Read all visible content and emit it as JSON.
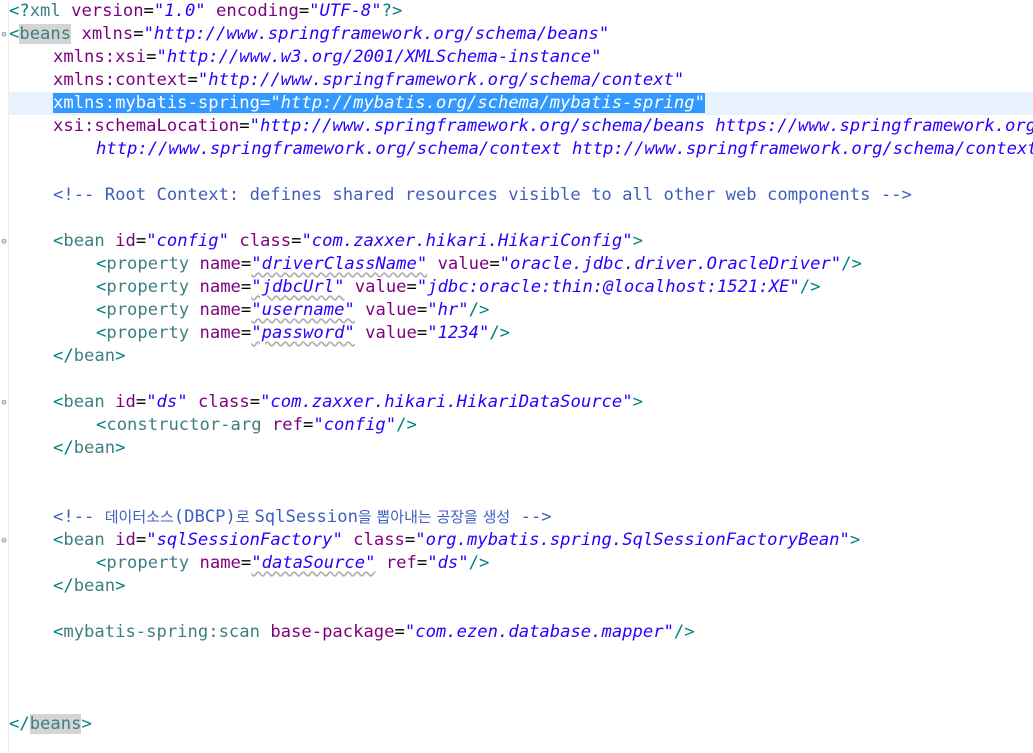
{
  "editor": {
    "lines": {
      "l1": {
        "open": "<?",
        "tag": "xml",
        "a1": "version",
        "v1": "\"1.0\"",
        "a2": "encoding",
        "v2": "\"UTF-8\"",
        "close": "?>"
      },
      "l2": {
        "open": "<",
        "tag": "beans",
        "a1": "xmlns",
        "v1": "\"http://www.springframework.org/schema/beans\""
      },
      "l3": {
        "a1": "xmlns:xsi",
        "v1": "\"http://www.w3.org/2001/XMLSchema-instance\""
      },
      "l4": {
        "a1": "xmlns:context",
        "v1": "\"http://www.springframework.org/schema/context\""
      },
      "l5": {
        "a1": "xmlns:mybatis-spring",
        "v1": "\"http://mybatis.org/schema/mybatis-spring\""
      },
      "l6": {
        "a1": "xsi:schemaLocation",
        "v1": "\"http://www.springframework.org/schema/beans https://www.springframework.org/schema/beans/spring-beans.xsd"
      },
      "l7": {
        "v1": "http://www.springframework.org/schema/context http://www.springframework.org/schema/context/spring-context.xsd\">"
      },
      "l9": {
        "comment": "<!-- Root Context: defines shared resources visible to all other web components -->"
      },
      "l11": {
        "open": "<",
        "tag": "bean",
        "a1": "id",
        "v1": "\"config\"",
        "a2": "class",
        "v2": "\"com.zaxxer.hikari.HikariConfig\"",
        "close": ">"
      },
      "l12": {
        "open": "<",
        "tag": "property",
        "a1": "name",
        "v1": "\"driverClassName\"",
        "a2": "value",
        "v2": "\"oracle.jdbc.driver.OracleDriver\"",
        "close": "/>"
      },
      "l13": {
        "open": "<",
        "tag": "property",
        "a1": "name",
        "v1": "\"jdbcUrl\"",
        "a2": "value",
        "v2": "\"jdbc:oracle:thin:@localhost:1521:XE\"",
        "close": "/>"
      },
      "l14": {
        "open": "<",
        "tag": "property",
        "a1": "name",
        "v1": "\"username\"",
        "a2": "value",
        "v2": "\"hr\"",
        "close": "/>"
      },
      "l15": {
        "open": "<",
        "tag": "property",
        "a1": "name",
        "v1": "\"password\"",
        "a2": "value",
        "v2": "\"1234\"",
        "close": "/>"
      },
      "l16": {
        "open": "</",
        "tag": "bean",
        "close": ">"
      },
      "l18": {
        "open": "<",
        "tag": "bean",
        "a1": "id",
        "v1": "\"ds\"",
        "a2": "class",
        "v2": "\"com.zaxxer.hikari.HikariDataSource\"",
        "close": ">"
      },
      "l19": {
        "open": "<",
        "tag": "constructor-arg",
        "a1": "ref",
        "v1": "\"config\"",
        "close": "/>"
      },
      "l20": {
        "open": "</",
        "tag": "bean",
        "close": ">"
      },
      "l23": {
        "c1": "<!-- ",
        "kor1": "데이터소스",
        "c2": "(DBCP)",
        "kor2": "로 ",
        "c3": "SqlSession",
        "kor3": "을 뽑아내는 공장을 생성",
        "c4": " -->"
      },
      "l24": {
        "open": "<",
        "tag": "bean",
        "a1": "id",
        "v1": "\"sqlSessionFactory\"",
        "a2": "class",
        "v2": "\"org.mybatis.spring.SqlSessionFactoryBean\"",
        "close": ">"
      },
      "l25": {
        "open": "<",
        "tag": "property",
        "a1": "name",
        "v1": "\"dataSource\"",
        "a2": "ref",
        "v2": "\"ds\"",
        "close": "/>"
      },
      "l26": {
        "open": "</",
        "tag": "bean",
        "close": ">"
      },
      "l28": {
        "open": "<",
        "tag": "mybatis-spring:scan",
        "a1": "base-package",
        "v1": "\"com.ezen.database.mapper\"",
        "close": "/>"
      },
      "l32": {
        "open": "</",
        "tag": "beans",
        "close": ">"
      }
    },
    "colors": {
      "tag": "#3f7f7f",
      "attribute": "#7f007f",
      "value": "#2a00ff",
      "comment": "#3f5fbf",
      "selection": "#3399ff",
      "current_line": "#e8f2fe"
    },
    "fold_icons": [
      "fold-toggle-icon"
    ]
  }
}
